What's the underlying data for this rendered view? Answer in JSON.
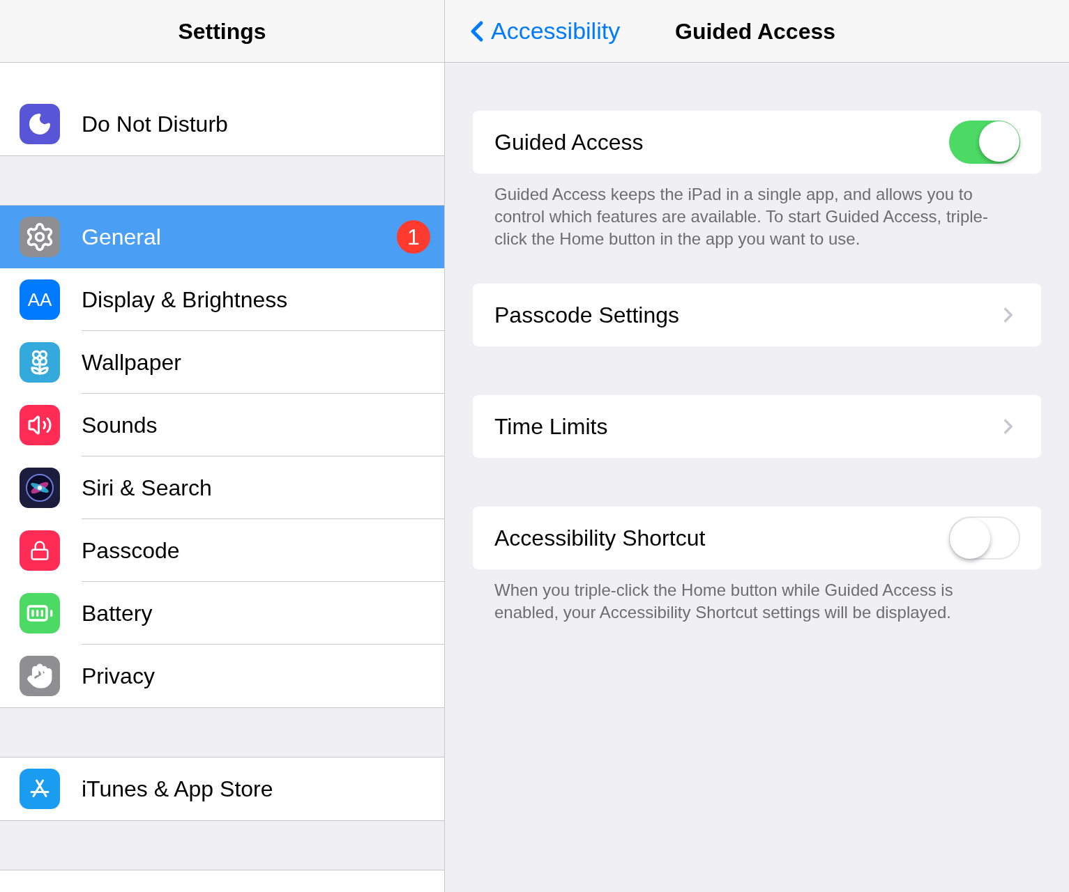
{
  "sidebar": {
    "title": "Settings",
    "groups": [
      [
        {
          "label": "Do Not Disturb",
          "color": "#5856d6",
          "selected": false
        }
      ],
      [
        {
          "label": "General",
          "color": "#8e8e93",
          "selected": true,
          "badge": "1"
        },
        {
          "label": "Display & Brightness",
          "color": "#007aff",
          "selected": false,
          "glyph": "AA"
        },
        {
          "label": "Wallpaper",
          "color": "#34aadc",
          "selected": false
        },
        {
          "label": "Sounds",
          "color": "#ff2d55",
          "selected": false
        },
        {
          "label": "Siri & Search",
          "color": "#1c1c3c",
          "selected": false
        },
        {
          "label": "Passcode",
          "color": "#ff2d55",
          "selected": false
        },
        {
          "label": "Battery",
          "color": "#4cd964",
          "selected": false
        },
        {
          "label": "Privacy",
          "color": "#8e8e93",
          "selected": false
        }
      ],
      [
        {
          "label": "iTunes & App Store",
          "color": "#1a9cf0",
          "selected": false
        }
      ]
    ]
  },
  "detail": {
    "back": "Accessibility",
    "title": "Guided Access",
    "sections": [
      {
        "rows": [
          {
            "kind": "toggle",
            "label": "Guided Access",
            "on": true
          }
        ],
        "footer": "Guided Access keeps the iPad in a single app, and allows you to control which features are available. To start Guided Access, triple-click the Home button in the app you want to use."
      },
      {
        "rows": [
          {
            "kind": "link",
            "label": "Passcode Settings"
          }
        ]
      },
      {
        "rows": [
          {
            "kind": "link",
            "label": "Time Limits"
          }
        ]
      },
      {
        "rows": [
          {
            "kind": "toggle",
            "label": "Accessibility Shortcut",
            "on": false
          }
        ],
        "footer": "When you triple-click the Home button while Guided Access is enabled, your Accessibility Shortcut settings will be displayed."
      }
    ]
  }
}
